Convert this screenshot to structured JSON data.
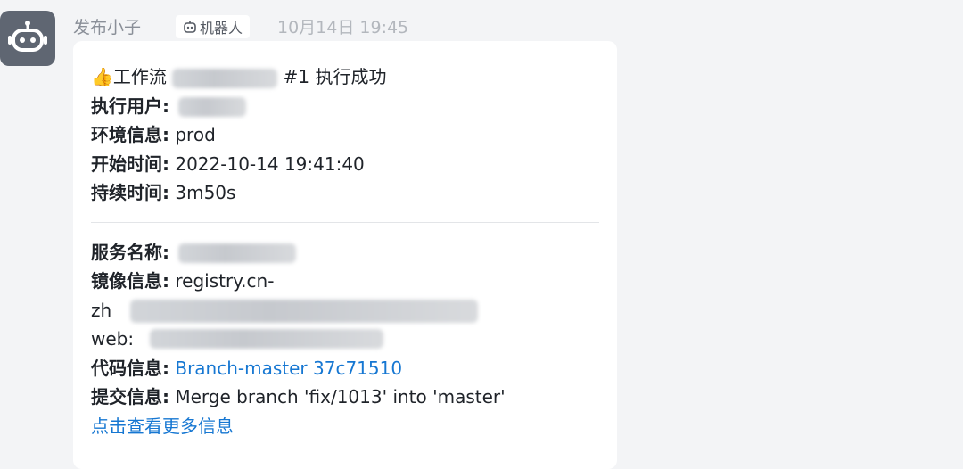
{
  "message": {
    "sender_name": "发布小子",
    "bot_badge": "机器人",
    "timestamp": "10月14日 19:45",
    "title_prefix": "👍工作流",
    "title_suffix": "#1 执行成功",
    "fields": {
      "user_label": "执行用户:",
      "env_label": "环境信息:",
      "env_value": "prod",
      "start_label": "开始时间:",
      "start_value": "2022-10-14 19:41:40",
      "duration_label": "持续时间:",
      "duration_value": "3m50s",
      "service_label": "服务名称:",
      "image_label": "镜像信息:",
      "image_value_line1": "registry.cn-",
      "image_value_line2": "zh",
      "image_value_line3": "web:",
      "code_label": "代码信息:",
      "code_value": "Branch-master 37c71510",
      "commit_label": "提交信息:",
      "commit_value": "Merge branch 'fix/1013' into 'master'"
    },
    "more_link": "点击查看更多信息"
  },
  "icons": {
    "avatar": "robot-icon",
    "badge": "robot-icon"
  },
  "colors": {
    "link": "#1677d2",
    "avatar_bg": "#5f6672",
    "background": "#f3f4f6"
  }
}
